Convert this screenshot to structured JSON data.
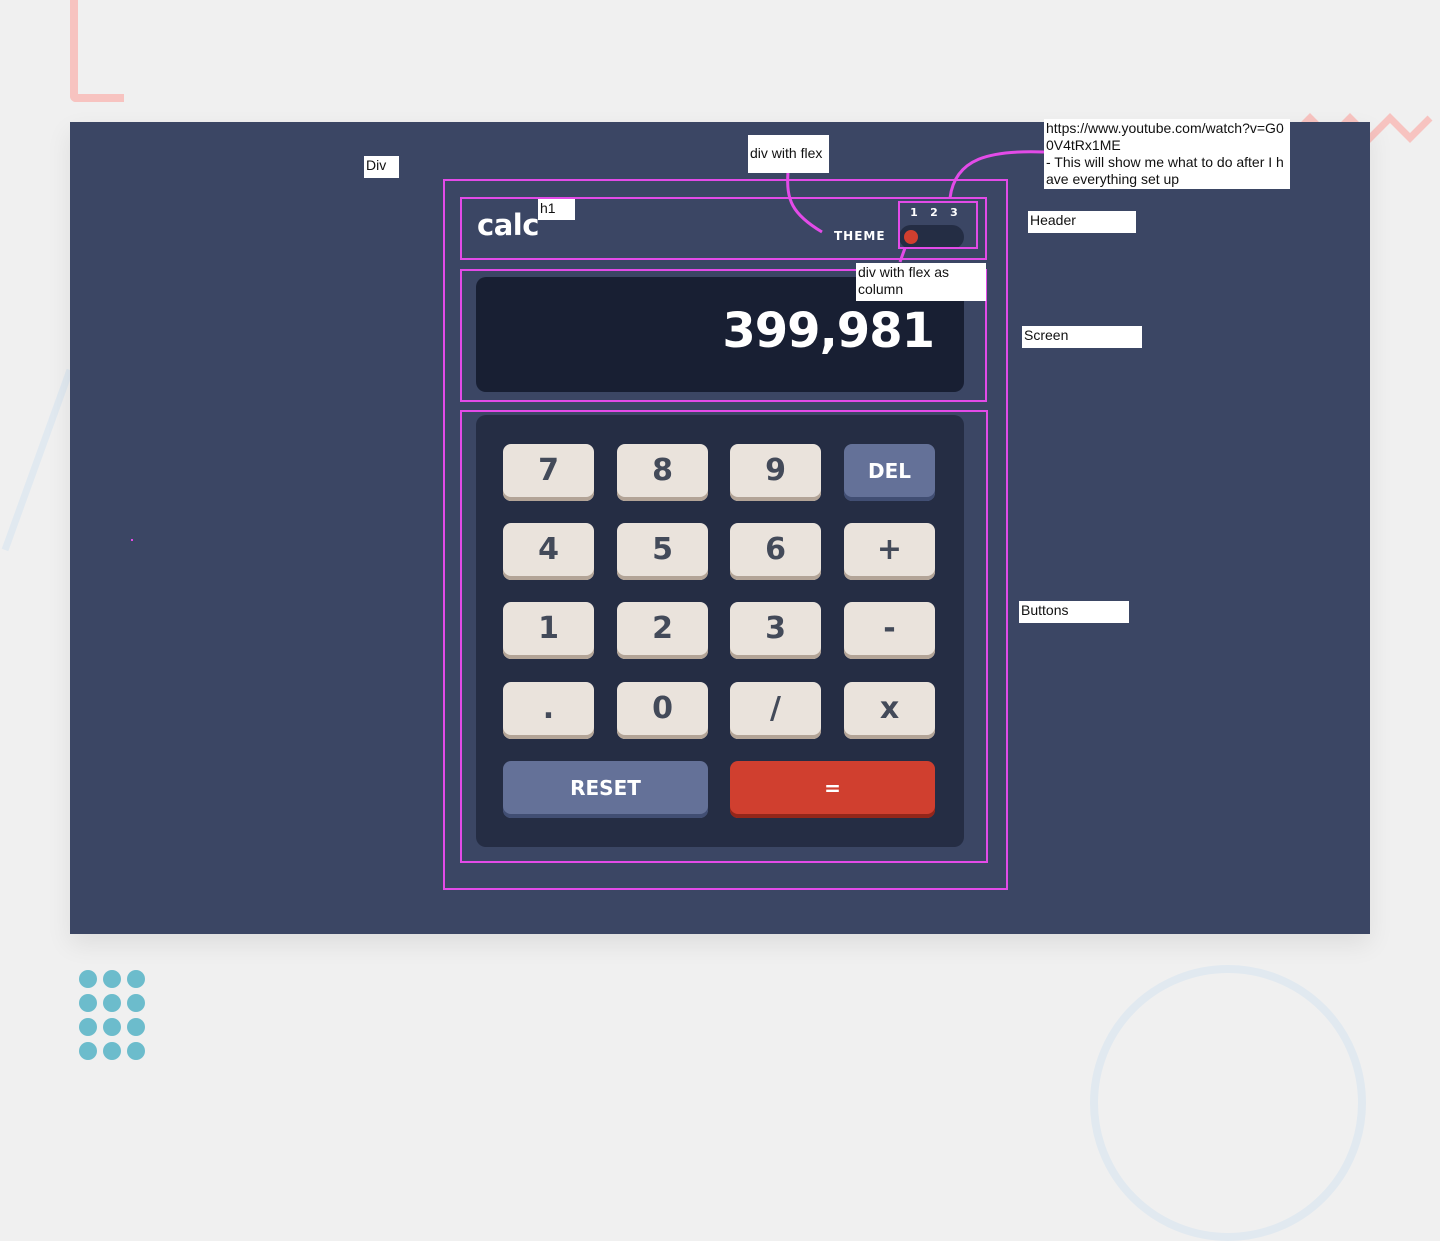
{
  "app": {
    "logo": "calc",
    "theme_label": "THEME",
    "theme_options": [
      "1",
      "2",
      "3"
    ],
    "selected_theme": "1",
    "display_value": "399,981"
  },
  "keys": [
    {
      "label": "7",
      "style": "default"
    },
    {
      "label": "8",
      "style": "default"
    },
    {
      "label": "9",
      "style": "default"
    },
    {
      "label": "DEL",
      "style": "blue"
    },
    {
      "label": "4",
      "style": "default"
    },
    {
      "label": "5",
      "style": "default"
    },
    {
      "label": "6",
      "style": "default"
    },
    {
      "label": "+",
      "style": "default"
    },
    {
      "label": "1",
      "style": "default"
    },
    {
      "label": "2",
      "style": "default"
    },
    {
      "label": "3",
      "style": "default"
    },
    {
      "label": "-",
      "style": "default"
    },
    {
      "label": ".",
      "style": "default"
    },
    {
      "label": "0",
      "style": "default"
    },
    {
      "label": "/",
      "style": "default"
    },
    {
      "label": "x",
      "style": "default"
    },
    {
      "label": "RESET",
      "style": "blue"
    },
    {
      "label": "=",
      "style": "red"
    }
  ],
  "annotations": {
    "div": "Div",
    "h1": "h1",
    "div_flex": "div with flex",
    "div_flex_column": "div with flex as column",
    "header": "Header",
    "screen": "Screen",
    "buttons": "Buttons",
    "youtube_note": "https://www.youtube.com/watch?v=G00V4tRx1ME\n- This will show me what to do after I have everything set up"
  },
  "colors": {
    "frame_bg": "#3b4664",
    "screen_bg": "#181f33",
    "keypad_bg": "#252d44",
    "key_bg": "#eae3dc",
    "key_blue": "#647198",
    "key_red": "#d03f2f",
    "annotation": "#e34be8"
  }
}
